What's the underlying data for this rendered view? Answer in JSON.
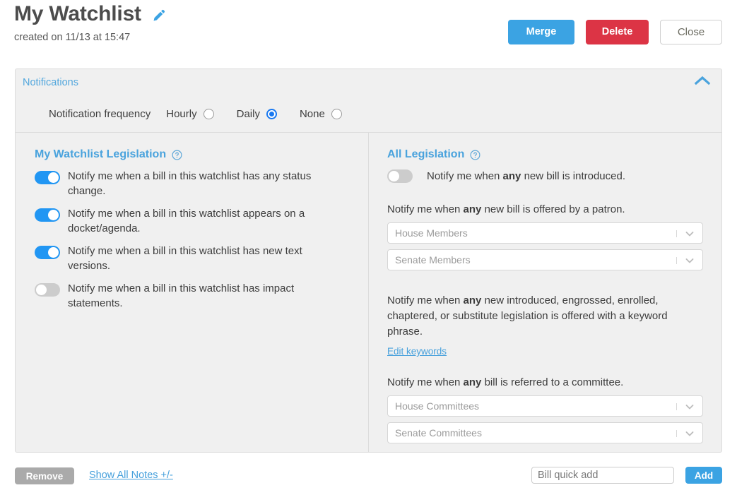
{
  "header": {
    "title": "My Watchlist",
    "subtitle": "created on 11/13 at 15:47",
    "edit_icon": "pencil-icon",
    "buttons": {
      "merge": "Merge",
      "delete": "Delete",
      "close": "Close"
    }
  },
  "colors": {
    "accent_blue": "#3ba3e3",
    "link_blue": "#46a0dc",
    "heading_blue": "#4aa3dd",
    "danger_red": "#dc3445",
    "toggle_on": "#2196f3",
    "toggle_off": "#cccccc",
    "radio_checked": "#1878f0",
    "panel_bg": "#f0f0f0",
    "panel_border": "#dcdcdc",
    "remove_gray": "#aaaaaa"
  },
  "panel": {
    "title": "Notifications",
    "collapse_icon": "chevron-up-icon",
    "frequency": {
      "label": "Notification frequency",
      "options": [
        {
          "label": "Hourly",
          "selected": false
        },
        {
          "label": "Daily",
          "selected": true
        },
        {
          "label": "None",
          "selected": false
        }
      ]
    }
  },
  "left_column": {
    "heading": "My Watchlist Legislation",
    "help_icon": "help-circle-icon",
    "toggles": [
      {
        "label": "Notify me when a bill in this watchlist has any status change.",
        "on": true
      },
      {
        "label": "Notify me when a bill in this watchlist appears on a docket/agenda.",
        "on": true
      },
      {
        "label": "Notify me when a bill in this watchlist has new text versions.",
        "on": true
      },
      {
        "label": "Notify me when a bill in this watchlist has impact statements.",
        "on": false
      }
    ]
  },
  "right_column": {
    "heading": "All Legislation",
    "help_icon": "help-circle-icon",
    "intro_toggle": {
      "text_before": "Notify me when ",
      "text_bold": "any",
      "text_after": " new bill is introduced.",
      "on": false
    },
    "patron_section": {
      "text_before": "Notify me when ",
      "text_bold": "any",
      "text_after": " new bill is offered by a patron.",
      "selects": [
        {
          "placeholder": "House Members",
          "chevron": "chevron-down-icon"
        },
        {
          "placeholder": "Senate Members",
          "chevron": "chevron-down-icon"
        }
      ]
    },
    "keyword_section": {
      "text_before": "Notify me when ",
      "text_bold": "any",
      "text_after": " new introduced, engrossed, enrolled, chaptered, or substitute legislation is offered with a keyword phrase.",
      "link": "Edit keywords"
    },
    "committee_section": {
      "text_before": "Notify me when ",
      "text_bold": "any",
      "text_after": " bill is referred to a committee.",
      "selects": [
        {
          "placeholder": "House Committees",
          "chevron": "chevron-down-icon"
        },
        {
          "placeholder": "Senate Committees",
          "chevron": "chevron-down-icon"
        }
      ]
    }
  },
  "footer": {
    "remove_label": "Remove",
    "notes_link": "Show All Notes +/-",
    "quick_add_placeholder": "Bill quick add",
    "quick_add_value": "",
    "add_label": "Add"
  }
}
